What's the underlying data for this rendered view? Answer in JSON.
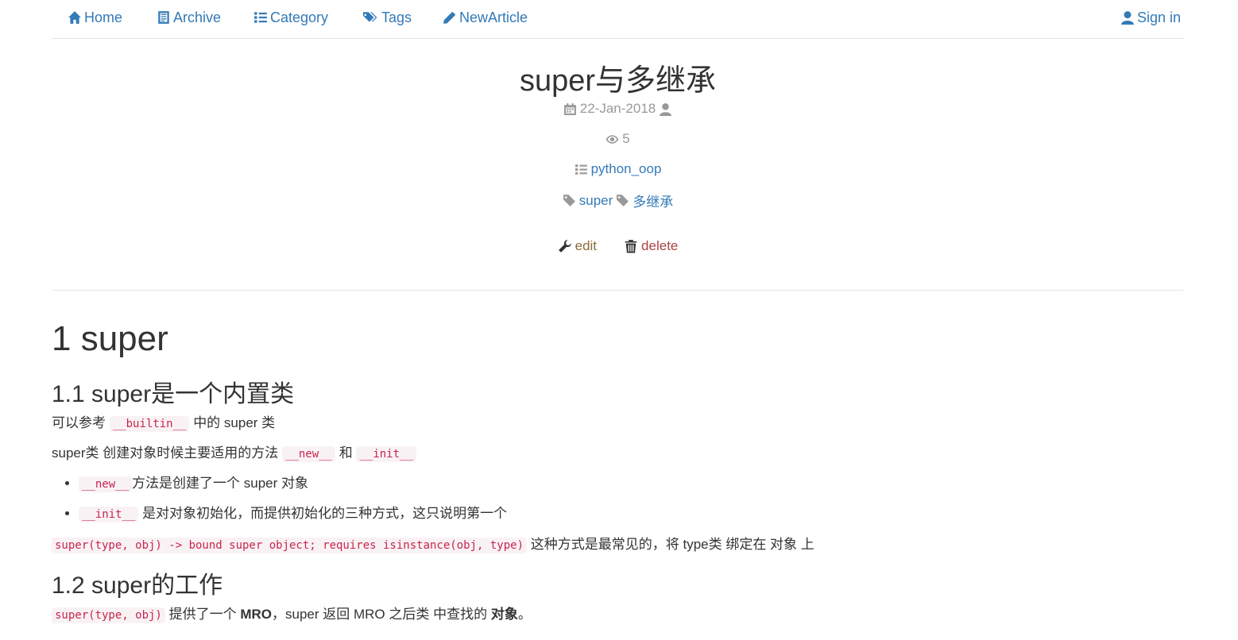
{
  "nav": {
    "home": "Home",
    "archive": "Archive",
    "category": "Category",
    "tags": "Tags",
    "new_article": "NewArticle",
    "sign_in": "Sign in"
  },
  "post": {
    "title": "super与多继承",
    "date": "22-Jan-2018",
    "views": "5",
    "category": "python_oop",
    "tags": [
      "super",
      "多继承"
    ],
    "edit_label": "edit",
    "delete_label": "delete"
  },
  "article": {
    "h1": "1 super",
    "s1": {
      "title": "1.1 super是一个内置类",
      "p1_a": "可以参考",
      "p1_code": "__builtin__",
      "p1_b": "中的 super 类",
      "p2_a": "super类 创建对象时候主要适用的方法",
      "p2_code1": "__new__",
      "p2_mid": "和",
      "p2_code2": "__init__",
      "li1_code": "__new__",
      "li1_text": "方法是创建了一个 super 对象",
      "li2_code": "__init__",
      "li2_text": "是对对象初始化，而提供初始化的三种方式，这只说明第一个",
      "p3_code": "super(type, obj) -> bound super object; requires isinstance(obj, type)",
      "p3_text": "这种方式是最常见的，将 type类 绑定在 对象 上"
    },
    "s2": {
      "title": "1.2 super的工作",
      "p1_code": "super(type, obj)",
      "p1_a": "提供了一个",
      "p1_bold1": "MRO",
      "p1_b": "，super 返回 MRO 之后类 中查找的",
      "p1_bold2": "对象",
      "p1_c": "。"
    }
  },
  "colors": {
    "link": "#337ab7",
    "muted": "#999999",
    "edit": "#8a6d3b",
    "delete": "#a94442",
    "code": "#c7254e"
  }
}
